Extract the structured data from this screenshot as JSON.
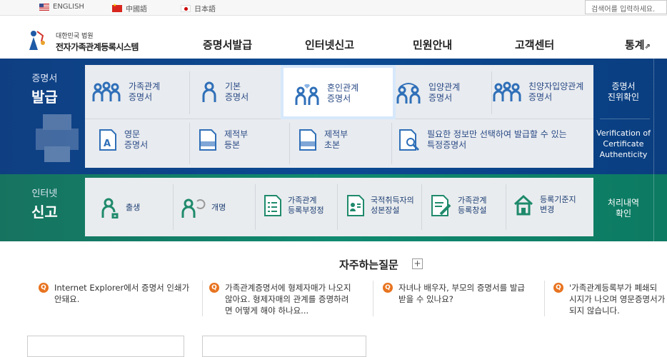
{
  "langbar": {
    "languages": [
      {
        "label": "ENGLISH",
        "flag": "us-flag-icon"
      },
      {
        "label": "中國語",
        "flag": "china-flag-icon"
      },
      {
        "label": "日本語",
        "flag": "japan-flag-icon"
      }
    ],
    "search_placeholder": "검색어를 입력하세요."
  },
  "header": {
    "logo_small": "대한민국 법원",
    "logo_big": "전자가족관계등록시스템",
    "nav": [
      "증명서발급",
      "인터넷신고",
      "민원안내",
      "고객센터",
      "통계"
    ]
  },
  "certificate": {
    "title_small": "증명서",
    "title_big": "발급",
    "row1": [
      {
        "line1": "가족관계",
        "line2": "증명서"
      },
      {
        "line1": "기본",
        "line2": "증명서"
      },
      {
        "line1": "혼인관계",
        "line2": "증명서"
      },
      {
        "line1": "입양관계",
        "line2": "증명서"
      },
      {
        "line1": "친양자입양관계",
        "line2": "증명서"
      }
    ],
    "row2": [
      {
        "line1": "영문",
        "line2": "증명서"
      },
      {
        "line1": "제적부",
        "line2": "등본"
      },
      {
        "line1": "제적부",
        "line2": "초본"
      },
      {
        "line1": "필요한 정보만 선택하여 발급할 수 있는",
        "line2": "특정증명서"
      }
    ],
    "side_top": {
      "line1": "증명서",
      "line2": "진위확인"
    },
    "side_bottom": {
      "line1": "Verification of",
      "line2": "Certificate",
      "line3": "Authenticity"
    }
  },
  "report": {
    "title_small": "인터넷",
    "title_big": "신고",
    "items": [
      {
        "line1": "출생",
        "line2": ""
      },
      {
        "line1": "개명",
        "line2": ""
      },
      {
        "line1": "가족관계",
        "line2": "등록부정정"
      },
      {
        "line1": "국적취득자의",
        "line2": "성본장설"
      },
      {
        "line1": "가족관계",
        "line2": "등록창설"
      },
      {
        "line1": "등록기준지",
        "line2": "변경"
      }
    ],
    "side": {
      "line1": "처리내역",
      "line2": "확인"
    }
  },
  "faq": {
    "title": "자주하는질문",
    "plus": "+",
    "badge": "Q",
    "items": [
      {
        "line1": "Internet Explorer에서 증명서 인쇄가",
        "line2": "안돼요.",
        "line3": ""
      },
      {
        "line1": "가족관계증명서에 형제자매가 나오지",
        "line2": "않아요. 형제자매의 관계를 증명하려",
        "line3": "면 어떻게 해야 하나요..."
      },
      {
        "line1": "자녀나 배우자, 부모의 증명서를 발급",
        "line2": "받을 수 있나요?",
        "line3": ""
      },
      {
        "line1": "'가족관계등록부가 폐쇄되",
        "line2": "시지가 나오며 영문증명서가",
        "line3": "되지 않습니다."
      }
    ]
  },
  "colors": {
    "cert_band": "#0b4a93",
    "report_band": "#0f8a70",
    "icon_blue": "#2f6fb8",
    "faq_badge": "#e8731f"
  }
}
